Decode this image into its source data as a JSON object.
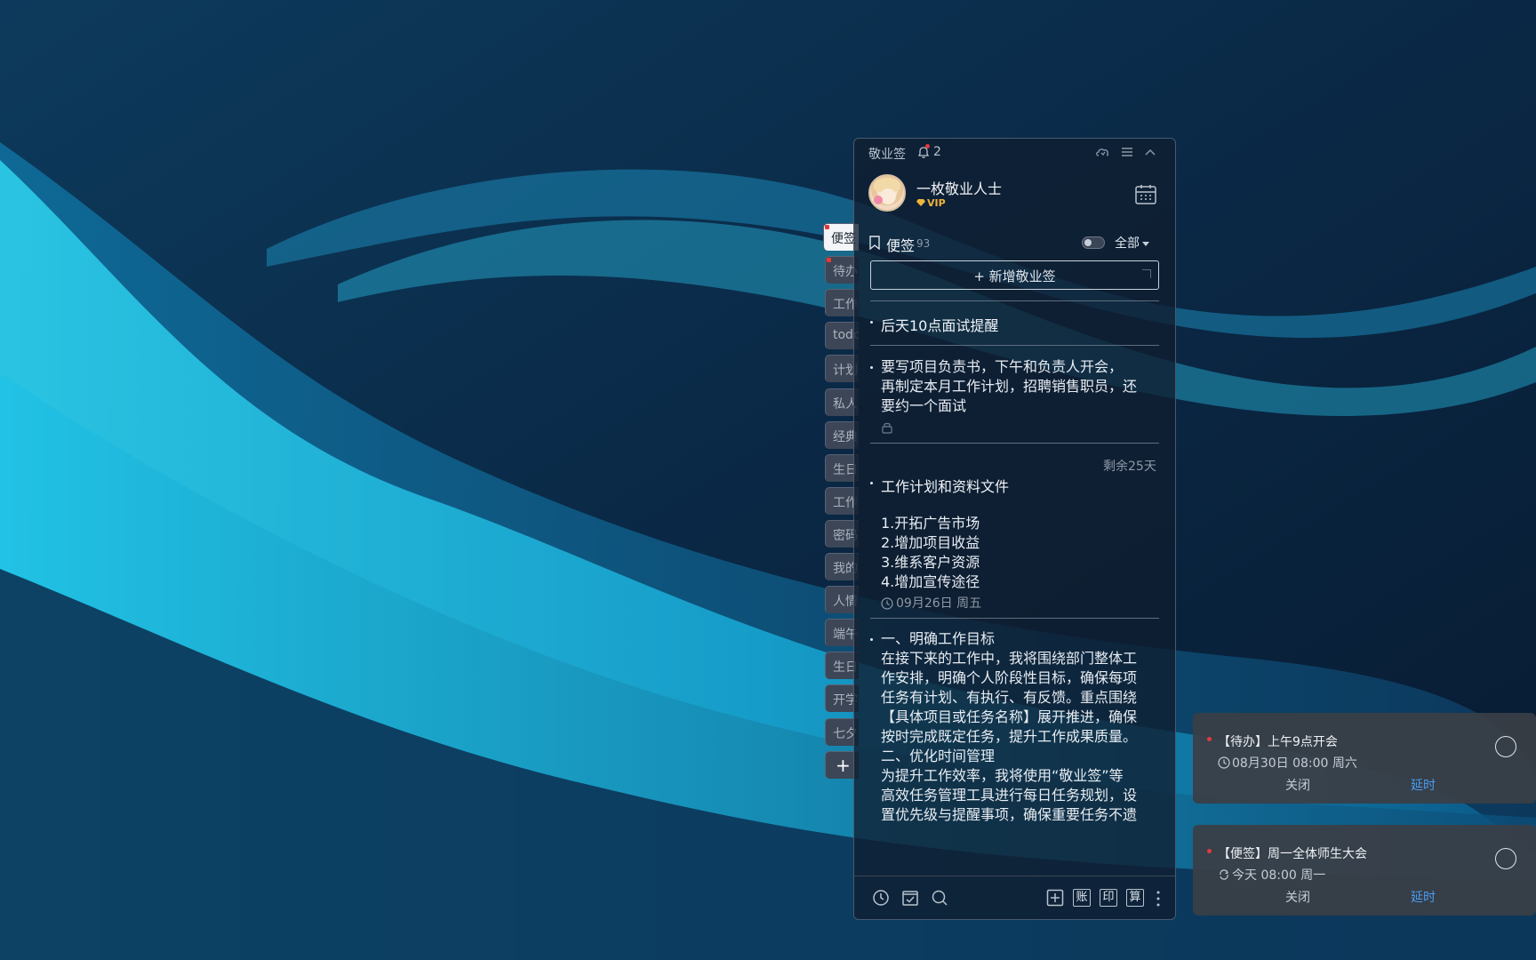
{
  "colors": {
    "accent_red": "#e23a3a",
    "link_blue": "#4a9cf0",
    "vip_gold": "#f0b43c",
    "panel_bg": "#101e30"
  },
  "side_tabs": [
    {
      "label": "便签",
      "active": true,
      "flag": true
    },
    {
      "label": "待办",
      "active": false,
      "flag": true
    },
    {
      "label": "工作",
      "active": false,
      "flag": false
    },
    {
      "label": "todo",
      "active": false,
      "flag": false
    },
    {
      "label": "计划",
      "active": false,
      "flag": false
    },
    {
      "label": "私人",
      "active": false,
      "flag": false
    },
    {
      "label": "经典",
      "active": false,
      "flag": false
    },
    {
      "label": "生日",
      "active": false,
      "flag": false
    },
    {
      "label": "工作",
      "active": false,
      "flag": false
    },
    {
      "label": "密码",
      "active": false,
      "flag": false
    },
    {
      "label": "我的",
      "active": false,
      "flag": false
    },
    {
      "label": "人情",
      "active": false,
      "flag": false
    },
    {
      "label": "端午",
      "active": false,
      "flag": false
    },
    {
      "label": "生日",
      "active": false,
      "flag": false
    },
    {
      "label": "开学",
      "active": false,
      "flag": false
    },
    {
      "label": "七夕",
      "active": false,
      "flag": false
    }
  ],
  "side_add_label": "+",
  "titlebar": {
    "app_name": "敬业签",
    "notification_count": "2",
    "icons": [
      "cloud-sync-icon",
      "menu-icon",
      "chevron-up-icon"
    ]
  },
  "profile": {
    "username": "一枚敬业人士",
    "badge": "VIP"
  },
  "section": {
    "label": "便签",
    "count": "93",
    "filter": "全部"
  },
  "new_note_label": "+ 新增敬业签",
  "notes": [
    {
      "title": "后天10点面试提醒"
    },
    {
      "lines": [
        "要写项目负责书，下午和负责人开会，",
        "再制定本月工作计划，招聘销售职员，还",
        "要约一个面试"
      ]
    },
    {
      "remaining": "剩余25天",
      "title": "工作计划和资料文件",
      "lines": [
        "1.开拓广告市场",
        "2.增加项目收益",
        "3.维系客户资源",
        "4.增加宣传途径"
      ],
      "date": "09月26日 周五"
    },
    {
      "lines": [
        "一、明确工作目标",
        "在接下来的工作中，我将围绕部门整体工",
        "作安排，明确个人阶段性目标，确保每项",
        "任务有计划、有执行、有反馈。重点围绕",
        "【具体项目或任务名称】展开推进，确保",
        "按时完成既定任务，提升工作成果质量。",
        "二、优化时间管理",
        "为提升工作效率，我将使用“敬业签”等",
        "高效任务管理工具进行每日任务规划，设",
        "置优先级与提醒事项，确保重要任务不遗"
      ]
    }
  ],
  "bottom_bar": {
    "text_buttons": [
      "账",
      "印",
      "算"
    ]
  },
  "reminders": [
    {
      "title": "【待办】上午9点开会",
      "time": "08月30日 08:00 周六",
      "close": "关闭",
      "delay": "延时",
      "time_icon": "clock-icon"
    },
    {
      "title": "【便签】周一全体师生大会",
      "time": "今天 08:00 周一",
      "close": "关闭",
      "delay": "延时",
      "time_icon": "repeat-icon"
    }
  ]
}
